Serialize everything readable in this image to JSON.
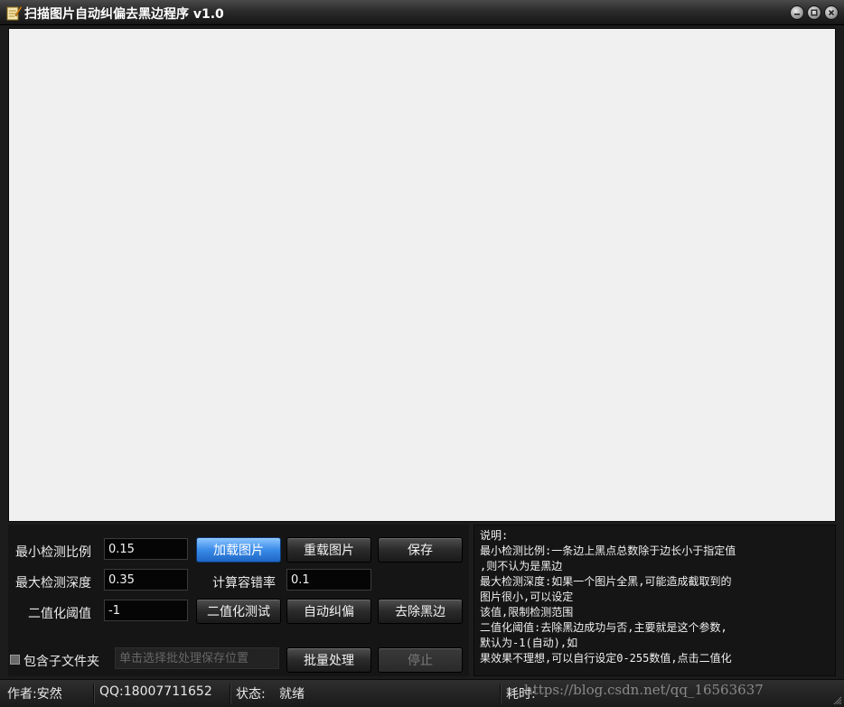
{
  "window": {
    "title": "扫描图片自动纠偏去黑边程序 v1.0"
  },
  "params": {
    "min_ratio_label": "最小检测比例",
    "min_ratio_value": "0.15",
    "max_depth_label": "最大检测深度",
    "max_depth_value": "0.35",
    "threshold_label": "二值化阈值",
    "threshold_value": "-1",
    "tolerance_label": "计算容错率",
    "tolerance_value": "0.1"
  },
  "buttons": {
    "load": "加载图片",
    "reload": "重载图片",
    "save": "保存",
    "binarize_test": "二值化测试",
    "auto_deskew": "自动纠偏",
    "remove_border": "去除黑边",
    "batch": "批量处理",
    "stop": "停止"
  },
  "batch": {
    "include_subfolders_label": "包含子文件夹",
    "save_path_placeholder": "单击选择批处理保存位置"
  },
  "help": {
    "lines": [
      "说明:",
      "最小检测比例:一条边上黑点总数除于边长小于指定值",
      ",则不认为是黑边",
      "最大检测深度:如果一个图片全黑,可能造成截取到的",
      "图片很小,可以设定",
      "该值,限制检测范围",
      "二值化阈值:去除黑边成功与否,主要就是这个参数,",
      "默认为-1(自动),如",
      "果效果不理想,可以自行设定0-255数值,点击二值化"
    ]
  },
  "status": {
    "author": "作者:安然",
    "qq": "QQ:18007711652",
    "state_label": "状态:",
    "state_value": "就绪",
    "elapsed_label": "耗时:",
    "watermark": "https://blog.csdn.net/qq_16563637"
  },
  "colors": {
    "primary_button": "#3a8be8",
    "background": "#1c1c1c",
    "canvas": "#f0f0f0"
  }
}
